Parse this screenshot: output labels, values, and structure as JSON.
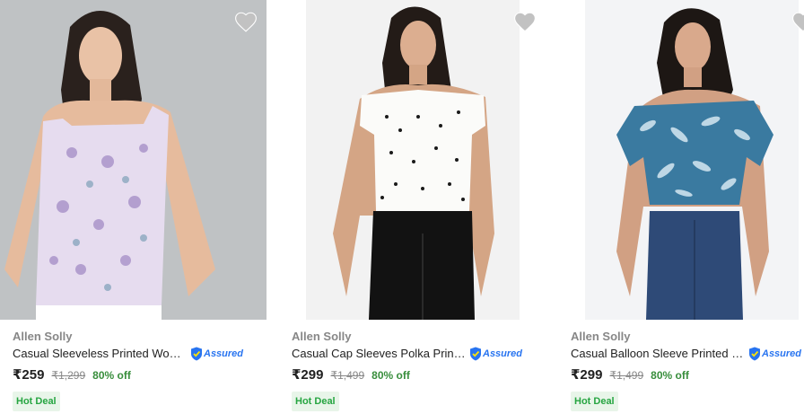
{
  "products": [
    {
      "brand": "Allen Solly",
      "title": "Casual Sleeveless Printed Women's Purple Top",
      "assured_label": "Assured",
      "price": "₹259",
      "mrp": "₹1,299",
      "discount": "80% off",
      "badge": "Hot Deal"
    },
    {
      "brand": "Allen Solly",
      "title": "Casual Cap Sleeves Polka Print Women White Top",
      "assured_label": "Assured",
      "price": "₹299",
      "mrp": "₹1,499",
      "discount": "80% off",
      "badge": "Hot Deal"
    },
    {
      "brand": "Allen Solly",
      "title": "Casual Balloon Sleeve Printed Women Blue Top",
      "assured_label": "Assured",
      "price": "₹299",
      "mrp": "₹1,499",
      "discount": "80% off",
      "badge": "Hot Deal"
    }
  ],
  "icons": {
    "wishlist": "heart-icon",
    "assured": "shield-icon"
  },
  "colors": {
    "discount": "#388e3c",
    "badge_bg": "#e8f5e9",
    "badge_text": "#26a541",
    "assured": "#2874f0",
    "muted": "#878787"
  }
}
